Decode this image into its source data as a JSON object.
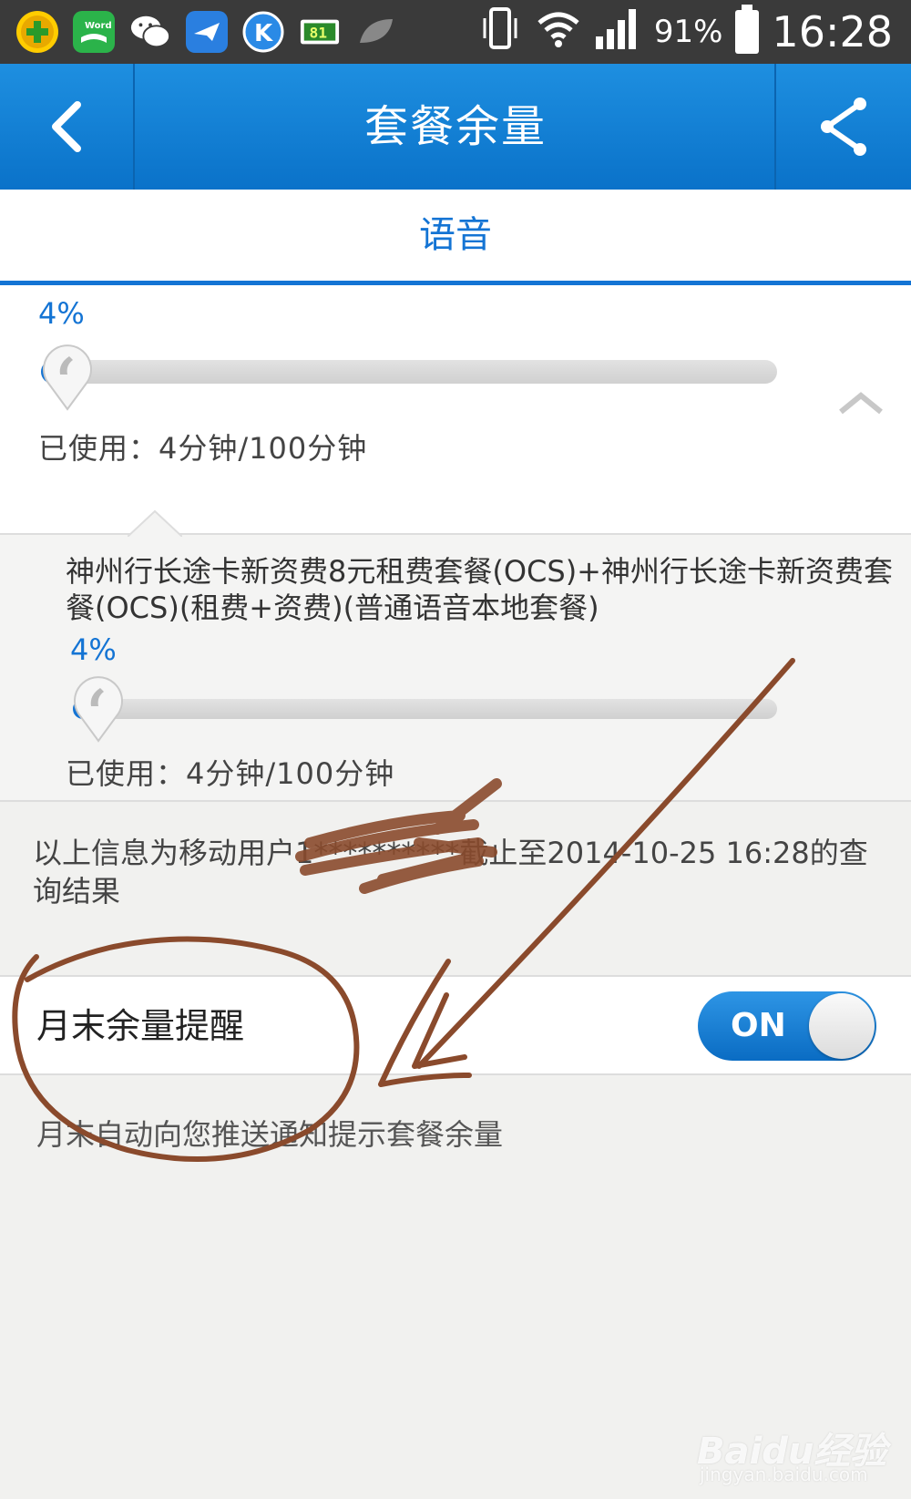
{
  "status_bar": {
    "battery_percent": "91%",
    "time": "16:28",
    "notification_icons": [
      "360-security-icon",
      "word-app-icon",
      "wechat-icon",
      "bird-app-icon",
      "k-app-icon",
      "digit-app-icon",
      "leaf-icon"
    ],
    "system_icons": [
      "vibrate-icon",
      "wifi-icon",
      "signal-icon",
      "battery-icon"
    ]
  },
  "header": {
    "title": "套餐余量",
    "back_icon": "chevron-left-icon",
    "share_icon": "share-icon",
    "color": "#0a72c9"
  },
  "tabs": [
    {
      "label": "语音",
      "active": true
    }
  ],
  "summary": {
    "percent": "4%",
    "used_fraction": 0.04,
    "used_label": "已使用：4分钟/100分钟"
  },
  "detail": {
    "plan_name": "神州行长途卡新资费8元租费套餐(OCS)+神州行长途卡新资费套餐(OCS)(租费+资费)(普通语音本地套餐)",
    "percent": "4%",
    "used_fraction": 0.04,
    "used_label": "已使用：4分钟/100分钟"
  },
  "info_text": "以上信息为移动用户1**********截止至2014-10-25 16:28的查询结果",
  "reminder": {
    "label": "月末余量提醒",
    "toggle_label": "ON",
    "toggle_on": true,
    "description": "月末自动向您推送通知提示套餐余量"
  },
  "watermark": {
    "main": "Baidu经验",
    "sub": "jingyan.baidu.com"
  },
  "colors": {
    "accent": "#1474d4",
    "annotation": "#8a4a2c"
  }
}
